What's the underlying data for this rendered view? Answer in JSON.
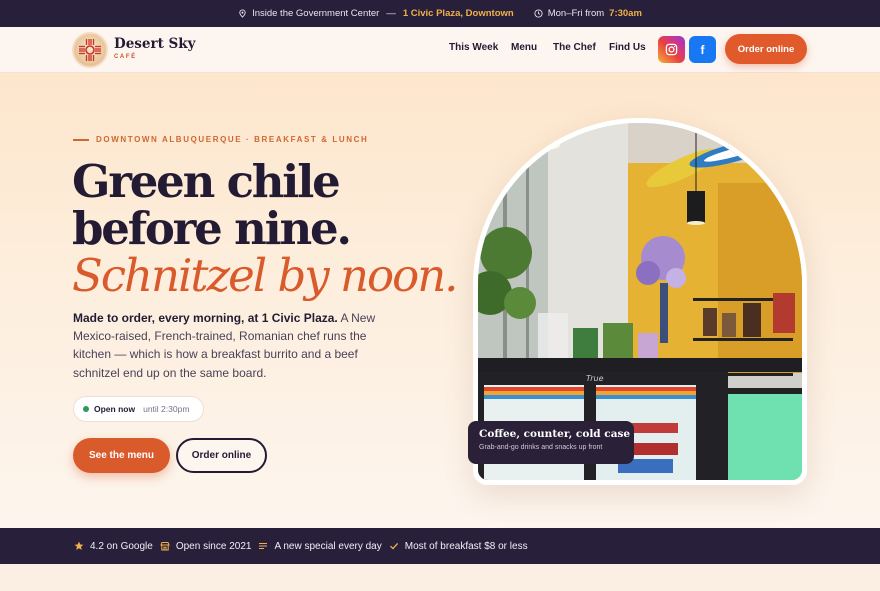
{
  "topbar": {
    "location_prefix": "Inside the Government Center",
    "separator": "—",
    "address": "1 Civic Plaza, Downtown",
    "hours_prefix": "Mon–Fri from",
    "hours_time": "7:30am"
  },
  "nav": {
    "brand_name": "Desert Sky",
    "brand_sub": "CAFÉ",
    "links": [
      "This Week",
      "Menu",
      "The Chef",
      "Find Us"
    ],
    "facebook_glyph": "f",
    "order_label": "Order online"
  },
  "hero": {
    "eyebrow": "DOWNTOWN ALBUQUERQUE · BREAKFAST & LUNCH",
    "headline_1": "Green chile",
    "headline_2": "before nine.",
    "headline_3": "Schnitzel by noon.",
    "lede_bold": "Made to order, every morning, at 1 Civic Plaza.",
    "lede_rest": " A New Mexico-raised, French-trained, Romanian chef runs the kitchen — which is how a breakfast burrito and a beef schnitzel end up on the same board.",
    "status_open": "Open now",
    "status_until": "until 2:30pm",
    "btn_menu": "See the menu",
    "btn_order": "Order online",
    "photo_caption_title": "Coffee, counter, cold case",
    "photo_caption_sub": "Grab-and-go drinks and snacks up front"
  },
  "strip": {
    "items": [
      "4.2 on Google",
      "Open since 2021",
      "A new special every day",
      "Most of breakfast $8 or less"
    ]
  },
  "icons": {
    "pin": "pin-icon",
    "clock": "clock-icon",
    "instagram": "instagram-icon",
    "facebook": "facebook-icon",
    "star": "star-icon",
    "store": "store-icon",
    "list": "list-icon",
    "check": "check-icon"
  },
  "colors": {
    "dark": "#281f3a",
    "accent": "#e05a2c",
    "gold": "#f1b14a",
    "open_dot": "#2c9a5a"
  }
}
